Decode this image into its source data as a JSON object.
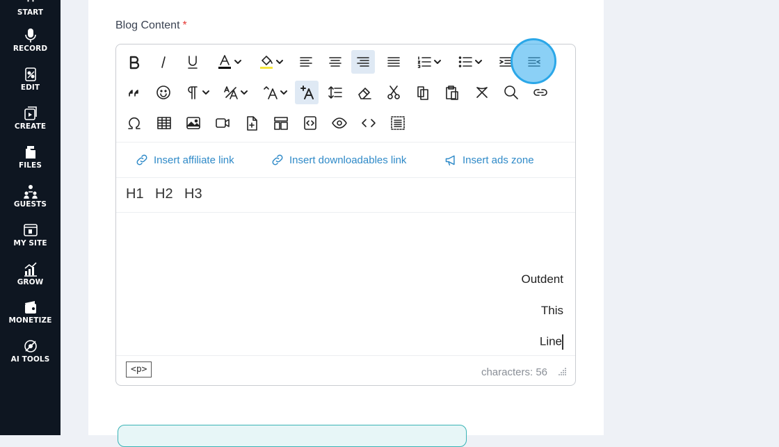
{
  "sidebar": {
    "items": [
      {
        "label": "START",
        "icon": "start-icon"
      },
      {
        "label": "RECORD",
        "icon": "microphone-icon"
      },
      {
        "label": "EDIT",
        "icon": "edit-icon"
      },
      {
        "label": "CREATE",
        "icon": "create-icon"
      },
      {
        "label": "FILES",
        "icon": "files-icon"
      },
      {
        "label": "GUESTS",
        "icon": "guests-icon"
      },
      {
        "label": "MY SITE",
        "icon": "my-site-icon"
      },
      {
        "label": "GROW",
        "icon": "grow-icon"
      },
      {
        "label": "MONETIZE",
        "icon": "monetize-icon"
      },
      {
        "label": "AI TOOLS",
        "icon": "ai-tools-icon"
      }
    ]
  },
  "field": {
    "label": "Blog Content",
    "required_mark": "*"
  },
  "insert_links": [
    {
      "label": "Insert affiliate link",
      "icon": "link-icon"
    },
    {
      "label": "Insert downloadables link",
      "icon": "link-icon"
    },
    {
      "label": "Insert ads zone",
      "icon": "megaphone-icon"
    }
  ],
  "headings": [
    "H1",
    "H2",
    "H3"
  ],
  "content": {
    "lines": [
      "Outdent",
      "This",
      "Line"
    ]
  },
  "status": {
    "tag": "<p>",
    "characters": "characters: 56"
  },
  "colors": {
    "sidebar_bg": "#0e1621",
    "accent": "#2ba7e8",
    "link": "#2f8ac8",
    "required": "#e53935"
  },
  "toolbar": {
    "active": [
      "align-right",
      "clear-formatting-plus"
    ],
    "highlighted": "outdent"
  }
}
